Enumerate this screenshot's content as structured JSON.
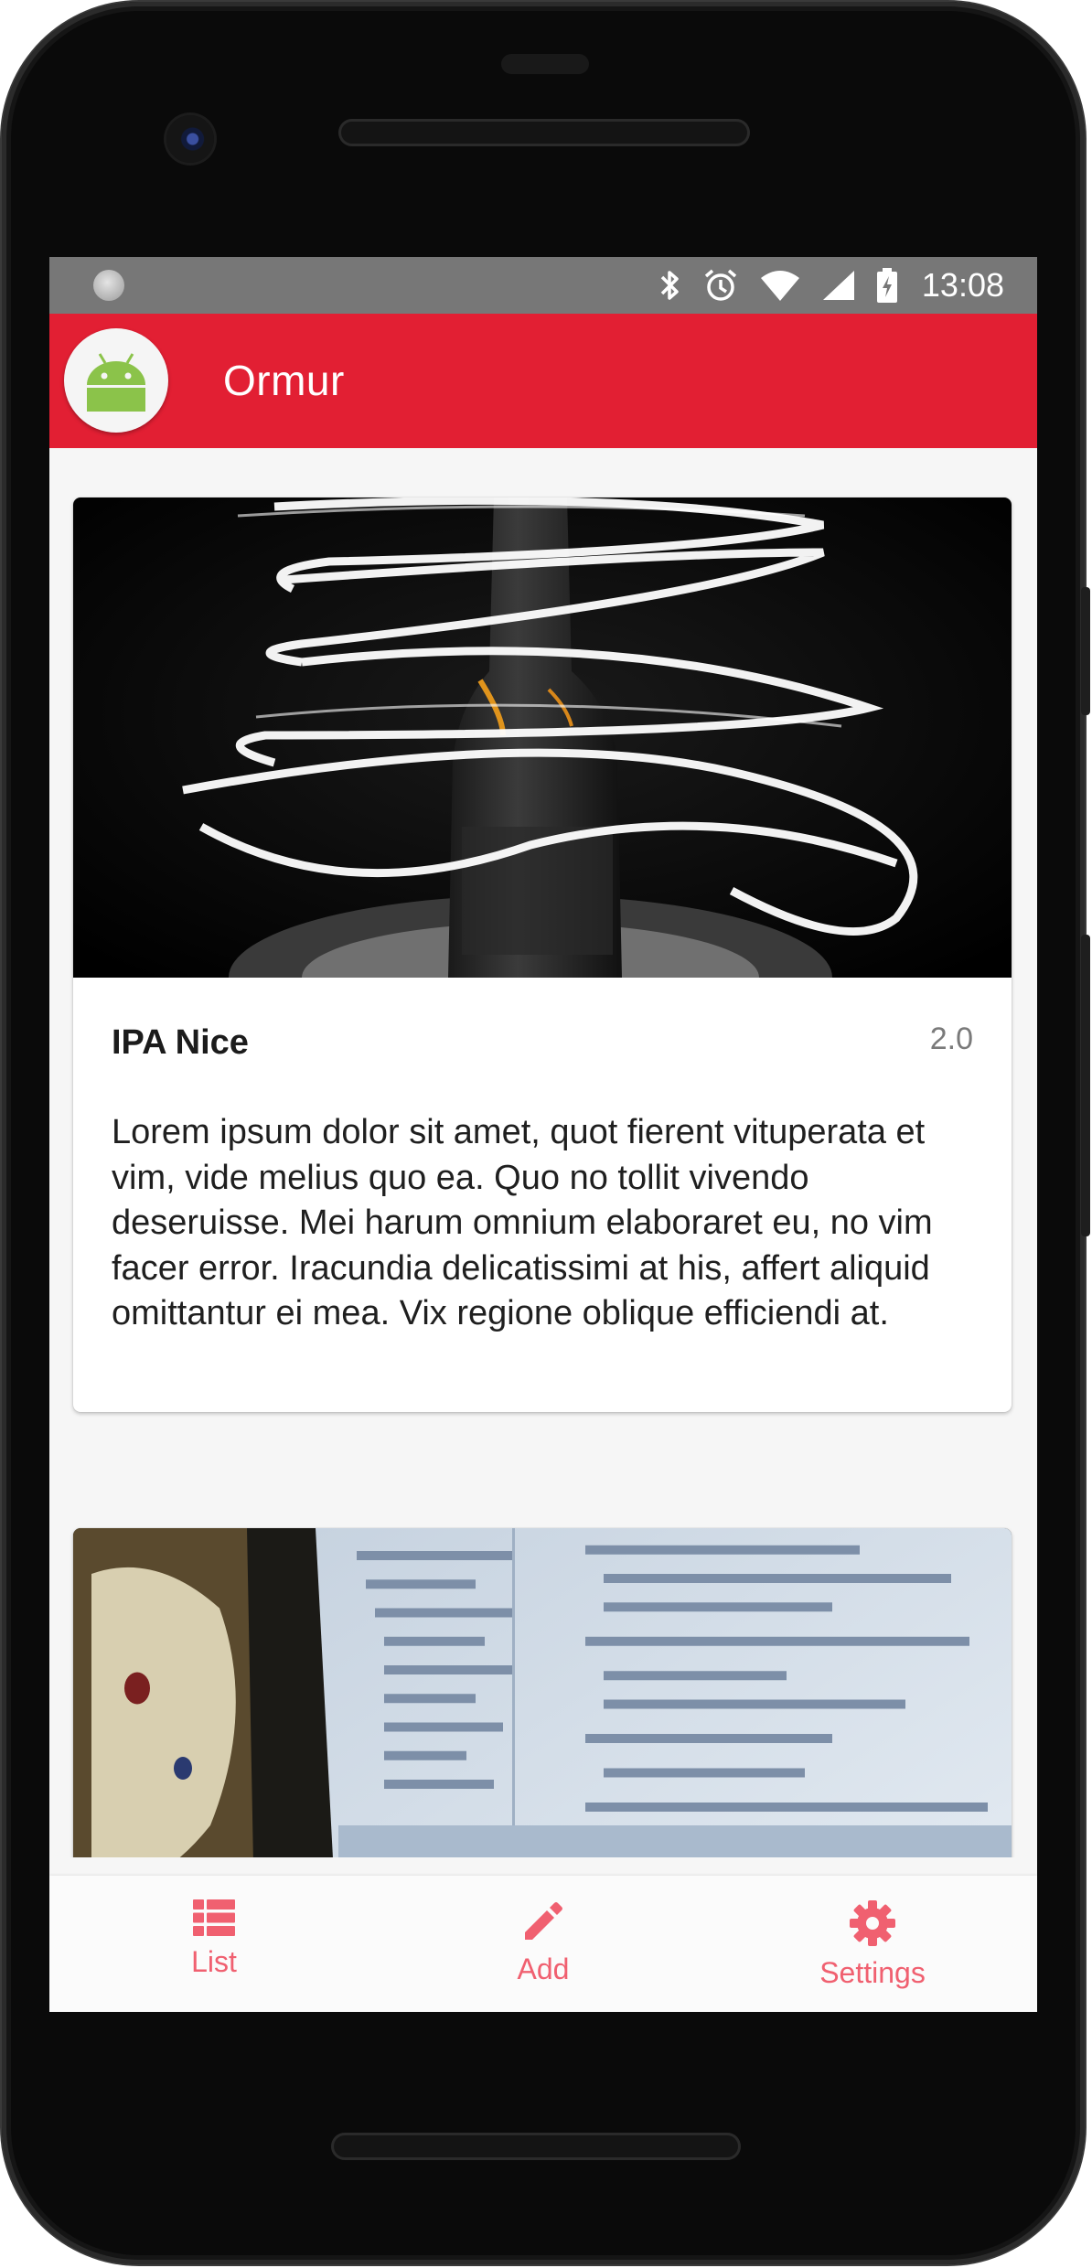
{
  "status_bar": {
    "time": "13:08",
    "icons": [
      "bluetooth-icon",
      "alarm-icon",
      "wifi-icon",
      "cellular-signal-icon",
      "battery-charging-icon"
    ]
  },
  "app_bar": {
    "title": "Ormur",
    "logo": "android-icon",
    "color": "#e21f33"
  },
  "beers": [
    {
      "name": "IPA Nice",
      "rating": "2.0",
      "description": "Lorem ipsum dolor sit amet, quot fierent vituperata et vim, vide melius quo ea. Quo no tollit vivendo deseruisse. Mei harum omnium elaboraret eu, no vim facer error. Iracundia delicatissimi at his, affert aliquid omittantur ei mea. Vix regione oblique efficiendi at.",
      "image": "beer-bottle-light-painting-photo"
    },
    {
      "image": "laptop-code-screen-photo"
    }
  ],
  "bottom_nav": {
    "accent": "#f06070",
    "items": [
      {
        "label": "List",
        "icon": "list-icon"
      },
      {
        "label": "Add",
        "icon": "pencil-icon"
      },
      {
        "label": "Settings",
        "icon": "gear-icon"
      }
    ]
  }
}
